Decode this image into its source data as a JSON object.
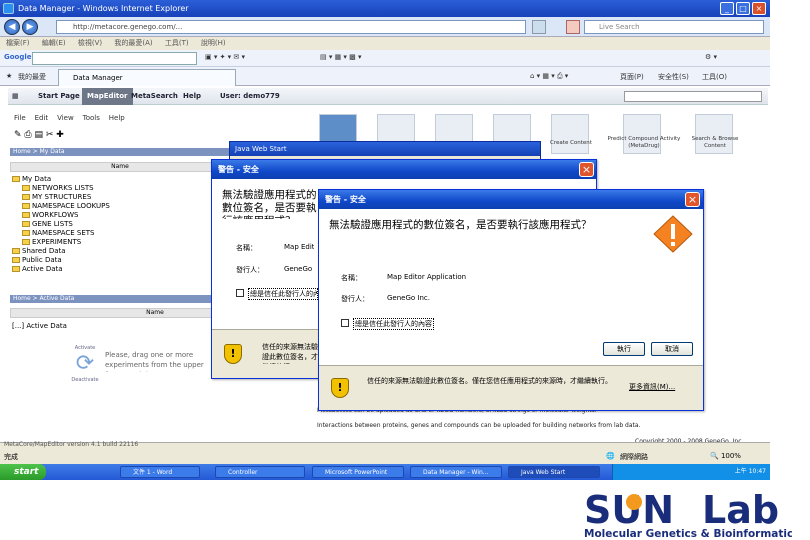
{
  "browser": {
    "title": "Data Manager - Windows Internet Explorer",
    "address": "http://metacore.genego.com/...",
    "search_placeholder": "Live Search",
    "menu": [
      "檔案(F)",
      "編輯(E)",
      "檢視(V)",
      "我的最愛(A)",
      "工具(T)",
      "說明(H)"
    ],
    "google_label": "Google",
    "favorites_label": "我的最愛",
    "tab_label": "Data Manager",
    "toolbar_right": [
      "頁面(P)",
      "安全性(S)",
      "工具(O)"
    ]
  },
  "app": {
    "nav": [
      "Start Page",
      "MapEditor",
      "MetaSearch",
      "Help",
      "User: demo779"
    ],
    "left_menu": [
      "File",
      "Edit",
      "View",
      "Tools",
      "Help"
    ],
    "breadcrumb": "Home > My Data",
    "column_name": "Name",
    "tree": [
      "My Data",
      "NETWORKS LISTS",
      "MY STRUCTURES",
      "NAMESPACE LOOKUPS",
      "WORKFLOWS",
      "GENE LISTS",
      "NAMESPACE SETS",
      "EXPERIMENTS",
      "Shared Data",
      "Public Data",
      "Active Data"
    ],
    "active_breadcrumb": "Home > Active Data",
    "active_item": "[...] Active Data",
    "help_text": "Please, drag one or more experiments from the upper frame and drop",
    "activate_label": "Activate",
    "deactivate_label": "Deactivate",
    "tools": [
      "Create Content",
      "Predict Compound Activity (MetaDrug)",
      "Search & Browse Content"
    ],
    "body_snippets": [
      "Metabolites can be uploaded as CAS or KEGG numbers, SMILES strings or molecular weights.",
      "Interactions between proteins, genes and compounds can be uploaded for building networks from lab data.",
      "Copyright 2000 - 2008 GeneGo, Inc."
    ],
    "status_left": "完成",
    "status_zone": "網際網路",
    "version": "MetaCore/MapEditor version 4.1 build 22116"
  },
  "java_web_start": {
    "title": "Java Web Start"
  },
  "dialog_back": {
    "title": "警告 - 安全",
    "heading": "無法驗證應用程式的數位簽名，是否要執行該應用程式？",
    "name_label": "名稱：",
    "name_value": "Map Editor Application",
    "publisher_label": "發行人：",
    "publisher_value": "GeneGo Inc.",
    "always_trust": "總是信任此發行人的內容",
    "warning": "信任的來源無法驗證此數位簽名，才繼續執行。"
  },
  "dialog_front": {
    "title": "警告 - 安全",
    "heading": "無法驗證應用程式的數位簽名，是否要執行該應用程式？",
    "name_label": "名稱：",
    "name_value": "Map Editor Application",
    "publisher_label": "發行人：",
    "publisher_value": "GeneGo Inc.",
    "always_trust": "總是信任此發行人的內容",
    "run_button": "執行",
    "cancel_button": "取消",
    "warning": "信任的來源無法驗證此數位簽名。僅在您信任應用程式的來源時，才繼續執行。",
    "more_info": "更多資訊(M)..."
  },
  "taskbar": {
    "start": "start",
    "items": [
      "文件 1 - Word",
      "Controller",
      "Microsoft PowerPoint",
      "Data Manager - Win...",
      "Java Web Start"
    ],
    "clock": "上午 10:47"
  },
  "logo": {
    "sun": "SUN",
    "lab": "Lab",
    "subtitle": "Molecular Genetics & Bioinformatics",
    "colors": {
      "navy": "#1a2d7a",
      "orange": "#f39a1e"
    }
  }
}
